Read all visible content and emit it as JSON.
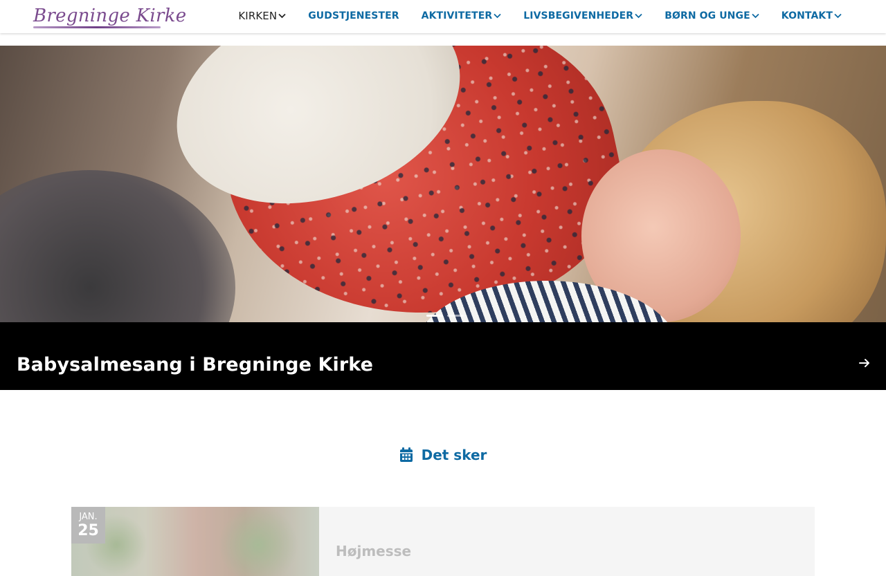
{
  "header": {
    "logo_text": "Bregninge Kirke",
    "nav": [
      {
        "label": "KIRKEN",
        "has_dropdown": true
      },
      {
        "label": "GUDSTJENESTER",
        "has_dropdown": false
      },
      {
        "label": "AKTIVITETER",
        "has_dropdown": true
      },
      {
        "label": "LIVSBEGIVENHEDER",
        "has_dropdown": true
      },
      {
        "label": "BØRN OG UNGE",
        "has_dropdown": true
      },
      {
        "label": "KONTAKT",
        "has_dropdown": true
      }
    ]
  },
  "hero": {
    "slides_count": 3,
    "active_slide": 1,
    "caption": "Babysalmesang i Bregninge Kirke",
    "arrow_icon": "arrow-right-icon"
  },
  "events_section": {
    "title": "Det sker",
    "icon": "calendar-icon"
  },
  "events": [
    {
      "month": "JAN.",
      "day": "25",
      "title": "Højmesse"
    }
  ],
  "colors": {
    "accent": "#0e6aa3",
    "logo": "#7a4a8e",
    "caption_bg": "#000000",
    "card_bg": "#f5f5f5",
    "date_badge": "#b9b9b9"
  }
}
